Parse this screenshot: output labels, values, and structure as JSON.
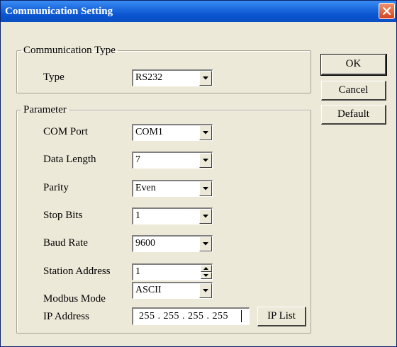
{
  "window": {
    "title": "Communication Setting",
    "close_icon": "close-icon"
  },
  "communication_type": {
    "legend": "Communication Type",
    "type_label": "Type",
    "type_value": "RS232"
  },
  "parameter": {
    "legend": "Parameter",
    "fields": [
      {
        "label": "COM Port",
        "value": "COM1"
      },
      {
        "label": "Data Length",
        "value": "7"
      },
      {
        "label": "Parity",
        "value": "Even"
      },
      {
        "label": "Stop Bits",
        "value": "1"
      },
      {
        "label": "Baud Rate",
        "value": "9600"
      },
      {
        "label": "Station Address",
        "value": "1"
      },
      {
        "label": "Modbus Mode",
        "value": "ASCII"
      },
      {
        "label": "IP Address",
        "value": "255 . 255 . 255 . 255"
      }
    ],
    "ip_list_label": "IP List"
  },
  "buttons": {
    "ok": "OK",
    "cancel": "Cancel",
    "default": "Default"
  },
  "colors": {
    "titlebar": "#0a54d0",
    "dialog_bg": "#ece9d8",
    "close_button": "#d6421f"
  }
}
